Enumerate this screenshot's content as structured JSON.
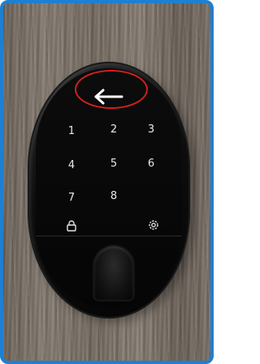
{
  "keypad": {
    "keys": [
      "1",
      "2",
      "3",
      "4",
      "5",
      "6",
      "7",
      "8"
    ]
  },
  "icons": {
    "arrow": "back-arrow-icon",
    "lock": "lock-icon",
    "settings": "gear-icon",
    "fingerprint": "fingerprint-sensor"
  },
  "colors": {
    "frame_border": "#1f7fd0",
    "highlight": "#d41f1f",
    "device": "#0a0a0a",
    "key_text": "#e8e8e8"
  }
}
